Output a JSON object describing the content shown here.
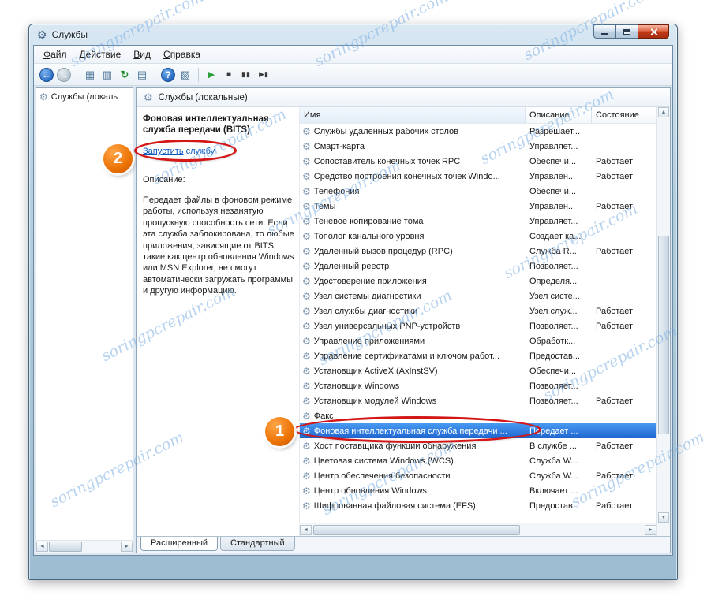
{
  "window": {
    "title": "Службы",
    "watermark": "soringpcrepair.com"
  },
  "menu": {
    "items": [
      {
        "label": "Файл"
      },
      {
        "label": "Действие"
      },
      {
        "label": "Вид"
      },
      {
        "label": "Справка"
      }
    ]
  },
  "toolbar": {
    "icons": [
      {
        "name": "back-icon",
        "glyph": "←"
      },
      {
        "name": "forward-icon",
        "glyph": "→"
      },
      {
        "sep": true
      },
      {
        "name": "console-window-icon",
        "glyph": "▦"
      },
      {
        "name": "list-view-icon",
        "glyph": "▥"
      },
      {
        "name": "refresh-icon",
        "glyph": "↻"
      },
      {
        "name": "export-list-icon",
        "glyph": "▤"
      },
      {
        "sep": true
      },
      {
        "name": "help-icon",
        "glyph": "?"
      },
      {
        "name": "action-pane-icon",
        "glyph": "▧"
      },
      {
        "sep": true
      },
      {
        "name": "start-service-icon",
        "glyph": "▶"
      },
      {
        "name": "stop-service-icon",
        "glyph": "■"
      },
      {
        "name": "pause-service-icon",
        "glyph": "▮▮"
      },
      {
        "name": "restart-service-icon",
        "glyph": "▶▮"
      }
    ]
  },
  "tree": {
    "root_label": "Службы (локаль"
  },
  "pane": {
    "header": "Службы (локальные)"
  },
  "details": {
    "service_title": "Фоновая интеллектуальная служба передачи (BITS)",
    "start_link_action": "Запустить",
    "start_link_rest": " службу",
    "description_label": "Описание:",
    "description_text": "Передает файлы в фоновом режиме работы, используя незанятую пропускную способность сети. Если эта служба заблокирована, то любые приложения, зависящие от BITS, такие как центр обновления Windows или MSN Explorer, не смогут автоматически загружать программы и другую информацию."
  },
  "services": {
    "columns": [
      {
        "label": "Имя"
      },
      {
        "label": "Описание"
      },
      {
        "label": "Состояние"
      }
    ],
    "rows": [
      {
        "name": "Службы удаленных рабочих столов",
        "desc": "Разрешает...",
        "status": ""
      },
      {
        "name": "Смарт-карта",
        "desc": "Управляет...",
        "status": ""
      },
      {
        "name": "Сопоставитель конечных точек RPC",
        "desc": "Обеспечи...",
        "status": "Работает"
      },
      {
        "name": "Средство построения конечных точек Windo...",
        "desc": "Управлен...",
        "status": "Работает"
      },
      {
        "name": "Телефония",
        "desc": "Обеспечи...",
        "status": ""
      },
      {
        "name": "Темы",
        "desc": "Управлен...",
        "status": "Работает"
      },
      {
        "name": "Теневое копирование тома",
        "desc": "Управляет...",
        "status": ""
      },
      {
        "name": "Тополог канального уровня",
        "desc": "Создает ка...",
        "status": ""
      },
      {
        "name": "Удаленный вызов процедур (RPC)",
        "desc": "Служба R...",
        "status": "Работает"
      },
      {
        "name": "Удаленный реестр",
        "desc": "Позволяет...",
        "status": ""
      },
      {
        "name": "Удостоверение приложения",
        "desc": "Определя...",
        "status": ""
      },
      {
        "name": "Узел системы диагностики",
        "desc": "Узел систе...",
        "status": ""
      },
      {
        "name": "Узел службы диагностики",
        "desc": "Узел служ...",
        "status": "Работает"
      },
      {
        "name": "Узел универсальных PNP-устройств",
        "desc": "Позволяет...",
        "status": "Работает"
      },
      {
        "name": "Управление приложениями",
        "desc": "Обработк...",
        "status": ""
      },
      {
        "name": "Управление сертификатами и ключом работ...",
        "desc": "Предостав...",
        "status": ""
      },
      {
        "name": "Установщик ActiveX (AxInstSV)",
        "desc": "Обеспечи...",
        "status": ""
      },
      {
        "name": "Установщик Windows",
        "desc": "Позволяет...",
        "status": ""
      },
      {
        "name": "Установщик модулей Windows",
        "desc": "Позволяет...",
        "status": "Работает"
      },
      {
        "name": "Факс",
        "desc": "",
        "status": ""
      },
      {
        "name": "Фоновая интеллектуальная служба передачи ...",
        "desc": "Передает ...",
        "status": "",
        "sel": true
      },
      {
        "name": "Хост поставщика функции обнаружения",
        "desc": "В службе ...",
        "status": "Работает"
      },
      {
        "name": "Цветовая система Windows (WCS)",
        "desc": "Служба W...",
        "status": ""
      },
      {
        "name": "Центр обеспечения безопасности",
        "desc": "Служба W...",
        "status": "Работает"
      },
      {
        "name": "Центр обновления Windows",
        "desc": "Включает ...",
        "status": ""
      },
      {
        "name": "Шифрованная файловая система (EFS)",
        "desc": "Предостав...",
        "status": "Работает"
      }
    ]
  },
  "tabs": {
    "items": [
      {
        "label": "Расширенный",
        "active": true
      },
      {
        "label": "Стандартный",
        "active": false
      }
    ]
  },
  "annotations": {
    "step1": "1",
    "step2": "2"
  }
}
